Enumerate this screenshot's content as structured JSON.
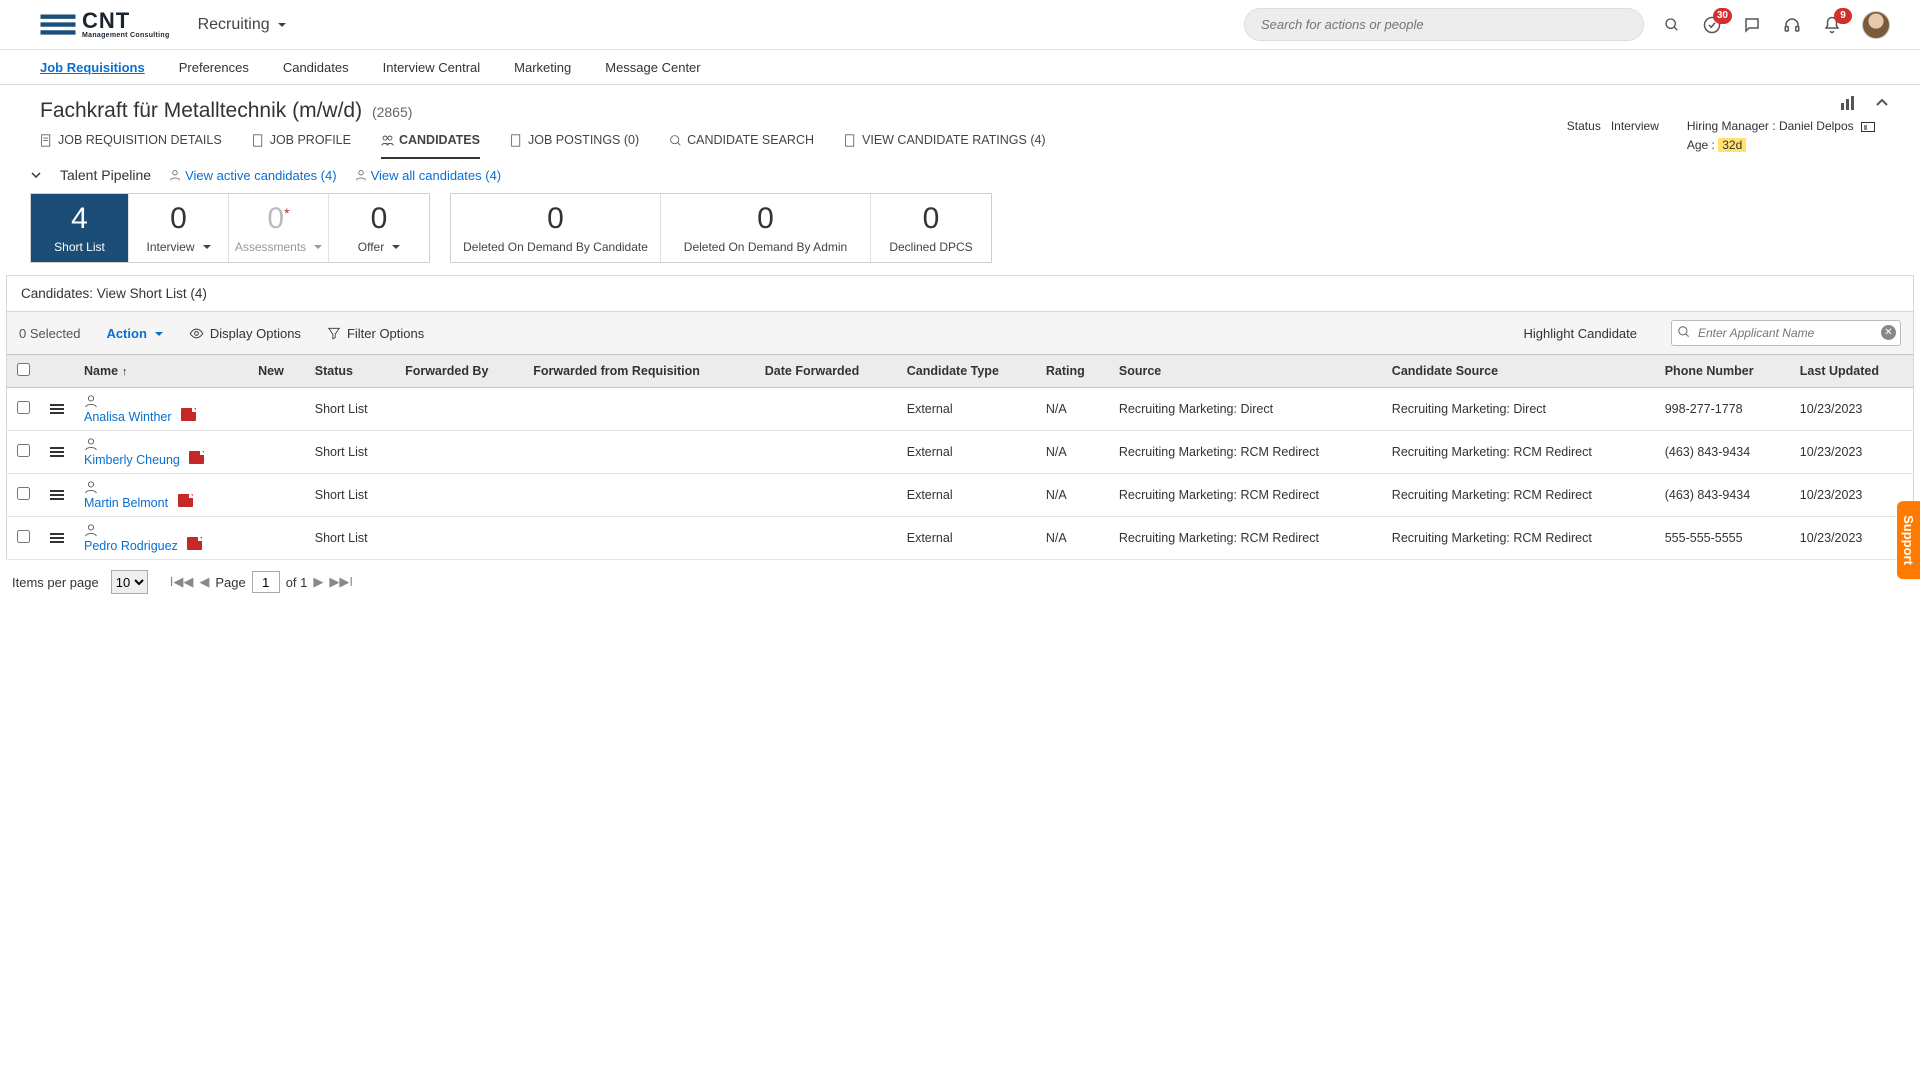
{
  "brand": {
    "name": "CNT",
    "sub": "Management Consulting"
  },
  "module": "Recruiting",
  "search_placeholder": "Search for actions or people",
  "topbar_badges": {
    "todo": "30",
    "bell": "9"
  },
  "nav": [
    "Job Requisitions",
    "Preferences",
    "Candidates",
    "Interview Central",
    "Marketing",
    "Message Center"
  ],
  "nav_active": 0,
  "req": {
    "title": "Fachkraft für Metalltechnik (m/w/d)",
    "id": "(2865)"
  },
  "meta": {
    "status_label": "Status",
    "status_value": "Interview",
    "hm_label": "Hiring Manager :",
    "hm_value": "Daniel Delpos",
    "age_label": "Age :",
    "age_value": "32d"
  },
  "subtabs": [
    "JOB REQUISITION DETAILS",
    "JOB PROFILE",
    "CANDIDATES",
    "JOB POSTINGS (0)",
    "CANDIDATE SEARCH",
    "VIEW CANDIDATE RATINGS (4)"
  ],
  "subtabs_active": 2,
  "pipeline": {
    "title": "Talent Pipeline",
    "link_active": "View active candidates (4)",
    "link_all": "View all candidates (4)",
    "group1": [
      {
        "count": "4",
        "label": "Short List",
        "selected": true
      },
      {
        "count": "0",
        "label": "Interview",
        "dd": true
      },
      {
        "count": "0",
        "label": "Assessments",
        "dd": true,
        "disabled": true,
        "ast": true
      },
      {
        "count": "0",
        "label": "Offer",
        "dd": true
      }
    ],
    "group2": [
      {
        "count": "0",
        "label": "Deleted On Demand By Candidate"
      },
      {
        "count": "0",
        "label": "Deleted On Demand By Admin"
      },
      {
        "count": "0",
        "label": "Declined DPCS"
      }
    ]
  },
  "banner": "Candidates: View Short List (4)",
  "toolbar": {
    "selected": "0 Selected",
    "action": "Action",
    "display": "Display Options",
    "filter": "Filter Options",
    "highlight": "Highlight Candidate",
    "search_placeholder": "Enter Applicant Name"
  },
  "columns": [
    "Name",
    "New",
    "Status",
    "Forwarded By",
    "Forwarded from Requisition",
    "Date Forwarded",
    "Candidate Type",
    "Rating",
    "Source",
    "Candidate Source",
    "Phone Number",
    "Last Updated"
  ],
  "rows": [
    {
      "name": "Analisa Winther",
      "status": "Short List",
      "type": "External",
      "rating": "N/A",
      "source": "Recruiting Marketing: Direct",
      "csource": "Recruiting Marketing: Direct",
      "phone": "998-277-1778",
      "updated": "10/23/2023"
    },
    {
      "name": "Kimberly Cheung",
      "status": "Short List",
      "type": "External",
      "rating": "N/A",
      "source": "Recruiting Marketing: RCM Redirect",
      "csource": "Recruiting Marketing: RCM Redirect",
      "phone": "(463) 843-9434",
      "updated": "10/23/2023"
    },
    {
      "name": "Martin Belmont",
      "status": "Short List",
      "type": "External",
      "rating": "N/A",
      "source": "Recruiting Marketing: RCM Redirect",
      "csource": "Recruiting Marketing: RCM Redirect",
      "phone": "(463) 843-9434",
      "updated": "10/23/2023"
    },
    {
      "name": "Pedro Rodriguez",
      "status": "Short List",
      "type": "External",
      "rating": "N/A",
      "source": "Recruiting Marketing: RCM Redirect",
      "csource": "Recruiting Marketing: RCM Redirect",
      "phone": "555-555-5555",
      "updated": "10/23/2023"
    }
  ],
  "pager": {
    "items_label": "Items per page",
    "items_value": "10",
    "page_label": "Page",
    "page_value": "1",
    "of_label": "of 1"
  },
  "support": "Support"
}
